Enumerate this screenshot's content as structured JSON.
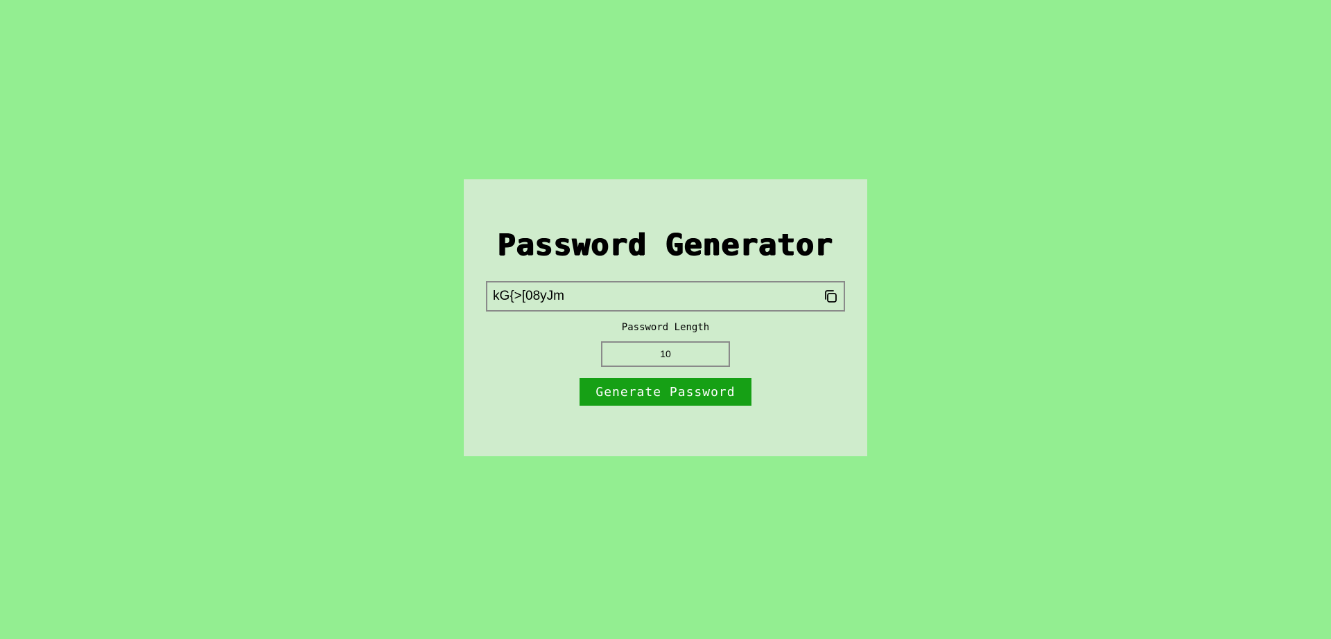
{
  "app": {
    "title": "Password Generator"
  },
  "output": {
    "password": "kG{>[08yJm",
    "copy_icon": "copy-icon"
  },
  "length": {
    "label": "Password Length",
    "value": "10"
  },
  "actions": {
    "generate_label": "Generate Password"
  },
  "colors": {
    "page_background": "#93ee91",
    "card_background": "#cfeccc",
    "button_background": "#16a015",
    "button_text": "#ffffff",
    "border": "#8a8a8a"
  }
}
